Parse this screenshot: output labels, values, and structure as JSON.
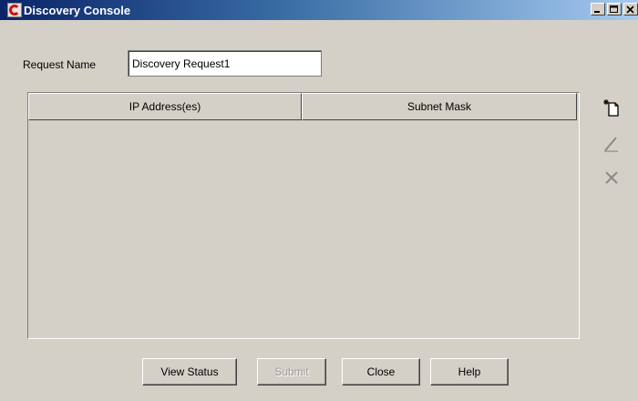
{
  "window": {
    "title": "Discovery Console",
    "controls": [
      "minimize-icon",
      "maximize-icon",
      "close-icon"
    ]
  },
  "form": {
    "request_name_label": "Request Name",
    "request_name_value": "Discovery Request1"
  },
  "table": {
    "columns": [
      "IP Address(es)",
      "Subnet Mask"
    ],
    "rows": []
  },
  "side_toolbar": {
    "icons": [
      "new-document-icon",
      "edit-pencil-icon",
      "delete-x-icon"
    ]
  },
  "buttons": {
    "view_status": "View Status",
    "submit": "Submit",
    "close": "Close",
    "help": "Help"
  },
  "colors": {
    "title_bar_start": "#0a246a",
    "title_bar_end": "#a6caf0",
    "window_bg": "#d4d0c8"
  }
}
